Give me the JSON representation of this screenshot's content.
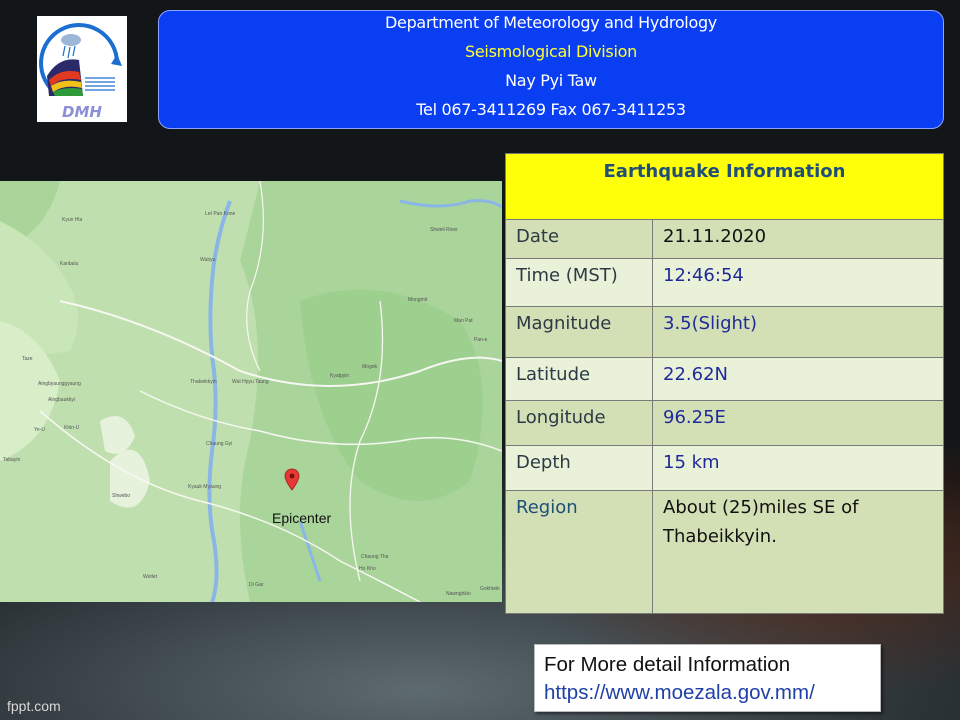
{
  "logo": {
    "icon": "dmh-logo-icon",
    "text": "DMH"
  },
  "header": {
    "line1": "Department of Meteorology and Hydrology",
    "line2": "Seismological Division",
    "line3": "Nay Pyi Taw",
    "line4": "Tel 067-3411269 Fax 067-3411253",
    "bg_color": "#0a3ef2",
    "line2_color": "#ffff33"
  },
  "map": {
    "epicenter_label": "Epicenter",
    "marker_icon": "map-pin-icon",
    "places": [
      "Kyun Hla",
      "Let Pan Kone",
      "Kanbalu",
      "Wabyu",
      "Shweli River",
      "Mongmit",
      "Man Pat",
      "Pan-e",
      "Taze",
      "Aingbyaunggyaung",
      "Thabeikkyin",
      "Wat Hpyu Taung",
      "Mogok",
      "Kyatpyin",
      "Aingbaukkyi",
      "Khin-U",
      "Ye-U",
      "Tabayin",
      "Chaung Gyi",
      "Kyauk Myaung",
      "Shwebo",
      "Wetlet",
      "Di Gar",
      "Chaung Tha",
      "Ho Kho",
      "Nawnghkio",
      "Gokhteik"
    ]
  },
  "info": {
    "title": "Earthquake Information",
    "title_bg": "#ffff0a",
    "rows": [
      {
        "key": "Date",
        "value": "21.11.2020"
      },
      {
        "key": "Time (MST)",
        "value": "12:46:54"
      },
      {
        "key": "Magnitude",
        "value": "3.5(Slight)"
      },
      {
        "key": "Latitude",
        "value": "22.62N"
      },
      {
        "key": "Longitude",
        "value": "96.25E"
      },
      {
        "key": "Depth",
        "value": "15 km"
      },
      {
        "key": "Region",
        "value": "About (25)miles SE of Thabeikkyin."
      }
    ]
  },
  "more": {
    "label": "For More detail Information",
    "url": "https://www.moezala.gov.mm/"
  },
  "footer": {
    "watermark": "fppt.com"
  }
}
